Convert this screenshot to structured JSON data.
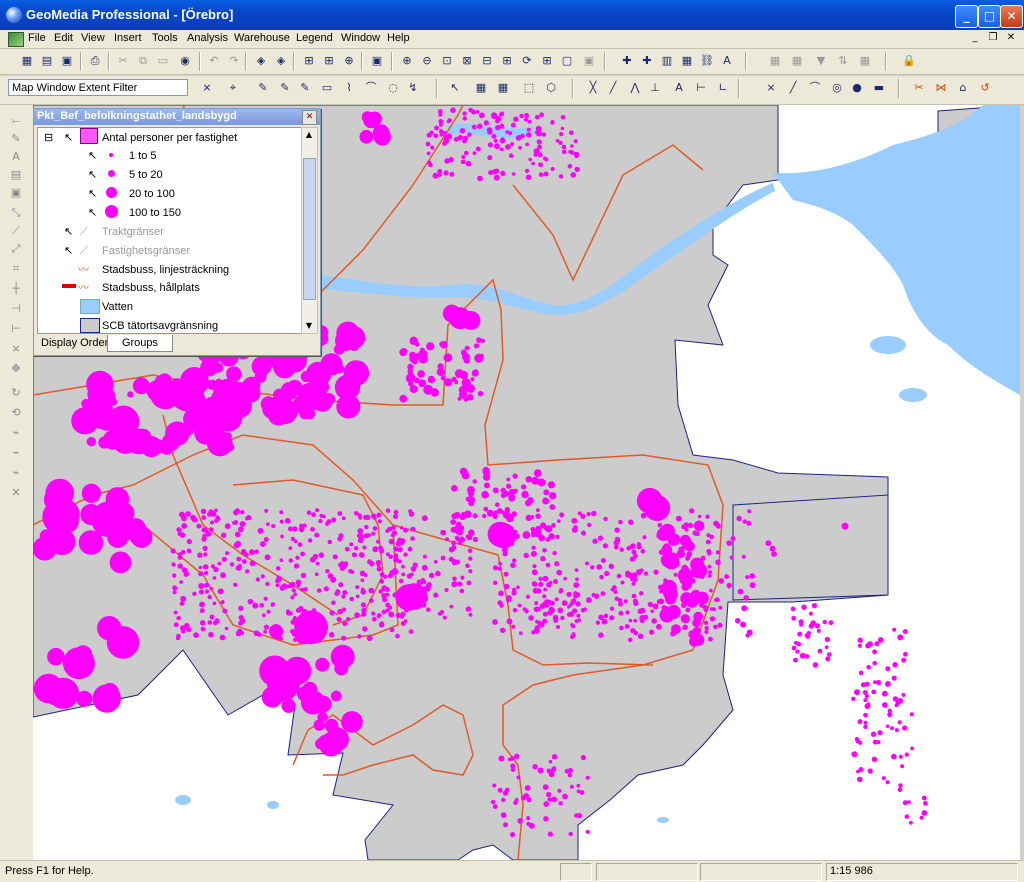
{
  "window": {
    "title": "GeoMedia Professional - [Örebro]"
  },
  "menu": {
    "items": [
      "File",
      "Edit",
      "View",
      "Insert",
      "Tools",
      "Analysis",
      "Warehouse",
      "Legend",
      "Window",
      "Help"
    ]
  },
  "toolbar2": {
    "filter_label": "Map Window Extent Filter"
  },
  "legend": {
    "title": "Pkt_Bef_befolkningstathet_landsbygd",
    "group_label": "Antal personer per fastighet",
    "classes": [
      "1 to 5",
      "5 to 20",
      "20 to 100",
      "100 to 150"
    ],
    "layers": [
      "Traktgränser",
      "Fastighetsgränser",
      "Stadsbuss, linjesträckning",
      "Stadsbuss, hållplats",
      "Vatten",
      "SCB tätortsavgränsning"
    ],
    "tabs": [
      "Display Order",
      "Groups"
    ]
  },
  "status": {
    "help": "Press F1 for Help.",
    "scale": "1:15 986"
  },
  "colors": {
    "points": "#ff00ff",
    "urban": "#cccccc",
    "water": "#99ccff",
    "bus": "#e05a2a",
    "border": "#1a237e"
  }
}
